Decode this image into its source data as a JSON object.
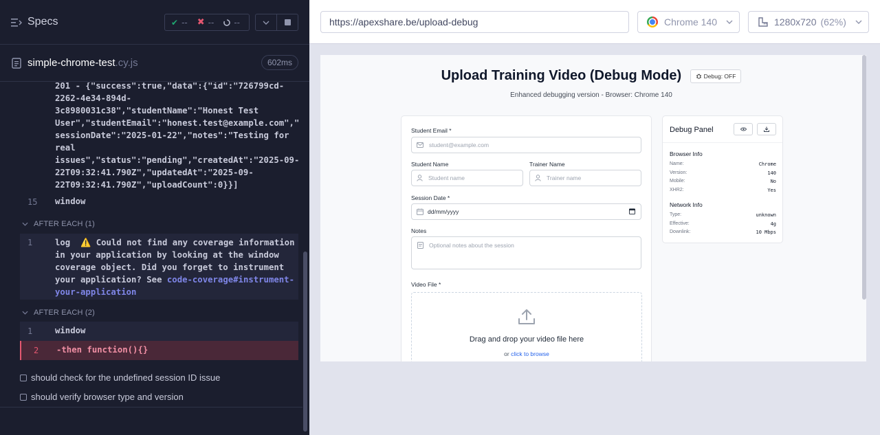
{
  "runner": {
    "specs_label": "Specs",
    "stats": {
      "passed": "--",
      "failed": "--",
      "pending": "--"
    },
    "spec_file": {
      "name": "simple-chrome-test",
      "ext": ".cy.js",
      "duration": "602ms"
    },
    "log": {
      "json_lines": [
        "201 - {\"success\":true,\"data\":{\"id\":\"726799cd-",
        "2262-4e34-894d-",
        "3c8980031c38\",\"studentName\":\"Honest Test",
        "User\",\"studentEmail\":\"honest.test@example.com\",\"",
        "sessionDate\":\"2025-01-22\",\"notes\":\"Testing for",
        "real",
        "issues\",\"status\":\"pending\",\"createdAt\":\"2025-09-",
        "22T09:32:41.790Z\",\"updatedAt\":\"2025-09-",
        "22T09:32:41.790Z\",\"uploadCount\":0}}]"
      ],
      "line15_num": "15",
      "line15_cmd": "window",
      "after_each_1": "AFTER EACH (1)",
      "ae1_num": "1",
      "ae1_cmd": "log",
      "ae1_warn_icon": "⚠️",
      "ae1_msg_lines": [
        "Could not find any coverage information",
        "in your application by looking at the window",
        "coverage object. Did you forget to instrument",
        "your application? See"
      ],
      "ae1_link_1": "code-coverage#instrument-",
      "ae1_link_2": "your-application",
      "after_each_2": "AFTER EACH (2)",
      "ae2_num1": "1",
      "ae2_cmd1": "window",
      "ae2_num2": "2",
      "ae2_cmd2": "-then  function(){}"
    },
    "tests": [
      "should check for the undefined session ID issue",
      "should verify browser type and version"
    ]
  },
  "browser": {
    "url": "https://apexshare.be/upload-debug",
    "browser_name": "Chrome 140",
    "viewport": "1280x720",
    "zoom": "(62%)"
  },
  "app": {
    "title": "Upload Training Video (Debug Mode)",
    "debug_badge": "Debug: OFF",
    "subtitle": "Enhanced debugging version - Browser: Chrome 140",
    "form": {
      "email_label": "Student Email *",
      "email_placeholder": "student@example.com",
      "student_name_label": "Student Name",
      "student_name_placeholder": "Student name",
      "trainer_name_label": "Trainer Name",
      "trainer_name_placeholder": "Trainer name",
      "session_date_label": "Session Date *",
      "session_date_value": "dd/mm/yyyy",
      "notes_label": "Notes",
      "notes_placeholder": "Optional notes about the session",
      "video_label": "Video File *",
      "drop_title": "Drag and drop your video file here",
      "drop_or": "or",
      "browse_link": "click to browse"
    },
    "debug_panel": {
      "title": "Debug Panel",
      "browser_info_title": "Browser Info",
      "browser_info": [
        {
          "k": "Name:",
          "v": "Chrome"
        },
        {
          "k": "Version:",
          "v": "140"
        },
        {
          "k": "Mobile:",
          "v": "No"
        },
        {
          "k": "XHR2:",
          "v": "Yes"
        }
      ],
      "network_info_title": "Network Info",
      "network_info": [
        {
          "k": "Type:",
          "v": "unknown"
        },
        {
          "k": "Effective:",
          "v": "4g"
        },
        {
          "k": "Downlink:",
          "v": "10 Mbps"
        }
      ]
    }
  },
  "colors": {
    "runner_bg": "#1b1e2e",
    "error_bg": "#4a2838",
    "error_accent": "#e45770",
    "link": "#7f86e8",
    "pass": "#1fa971"
  }
}
